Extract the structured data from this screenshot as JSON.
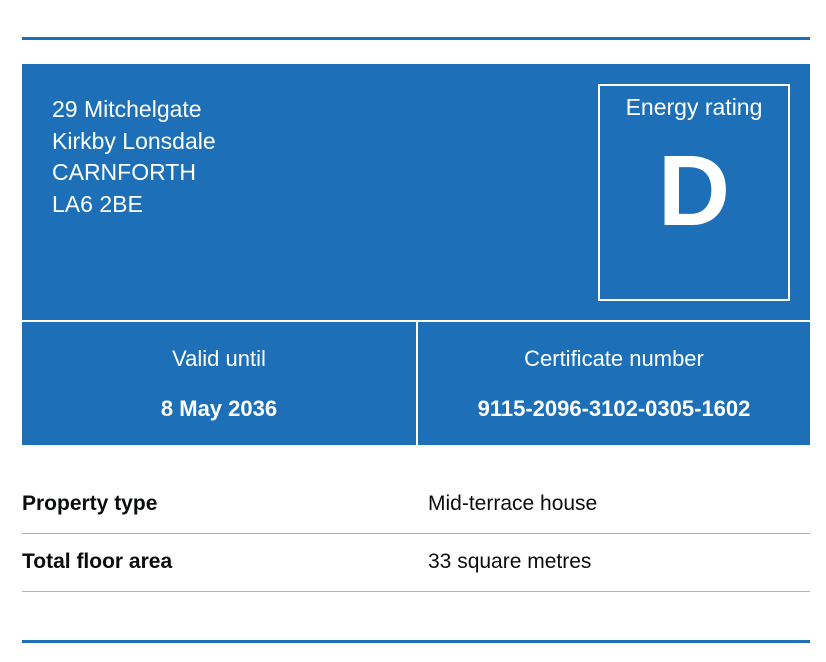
{
  "address": {
    "line1": "29 Mitchelgate",
    "line2": "Kirkby Lonsdale",
    "line3": "CARNFORTH",
    "postcode": "LA6 2BE"
  },
  "rating": {
    "label": "Energy rating",
    "value": "D"
  },
  "valid_until": {
    "label": "Valid until",
    "value": "8 May 2036"
  },
  "certificate": {
    "label": "Certificate number",
    "value": "9115-2096-3102-0305-1602"
  },
  "summary": {
    "rows": [
      {
        "key": "Property type",
        "value": "Mid-terrace house"
      },
      {
        "key": "Total floor area",
        "value": "33 square metres"
      }
    ]
  },
  "colors": {
    "brand_blue": "#1d70b8",
    "divider_grey": "#b1b4b6"
  }
}
